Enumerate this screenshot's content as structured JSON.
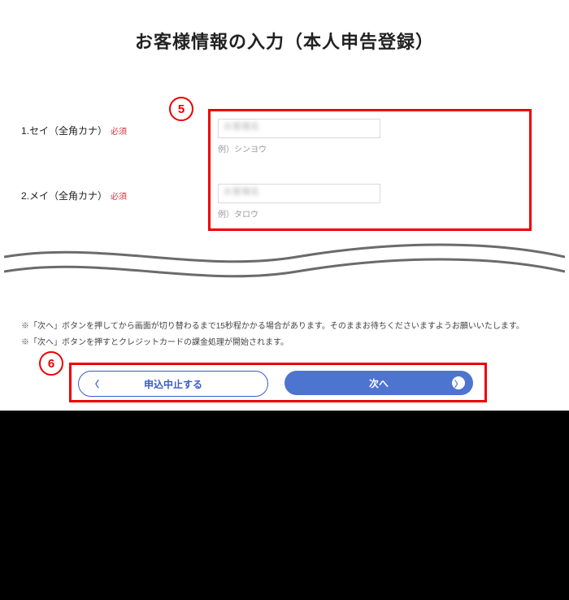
{
  "title": "お客様情報の入力（本人申告登録）",
  "callouts": {
    "five": "5",
    "six": "6"
  },
  "field1": {
    "label": "1.セイ（全角カナ）",
    "required": "必須",
    "example": "例）シンヨウ"
  },
  "field2": {
    "label": "2.メイ（全角カナ）",
    "required": "必須",
    "example": "例）タロウ"
  },
  "notes": {
    "line1": "※「次へ」ボタンを押してから画面が切り替わるまで15秒程かかる場合があります。そのままお待ちくださいますようお願いいたします。",
    "line2": "※「次へ」ボタンを押すとクレジットカードの課金処理が開始されます。"
  },
  "buttons": {
    "cancel": "申込中止する",
    "next": "次へ"
  }
}
